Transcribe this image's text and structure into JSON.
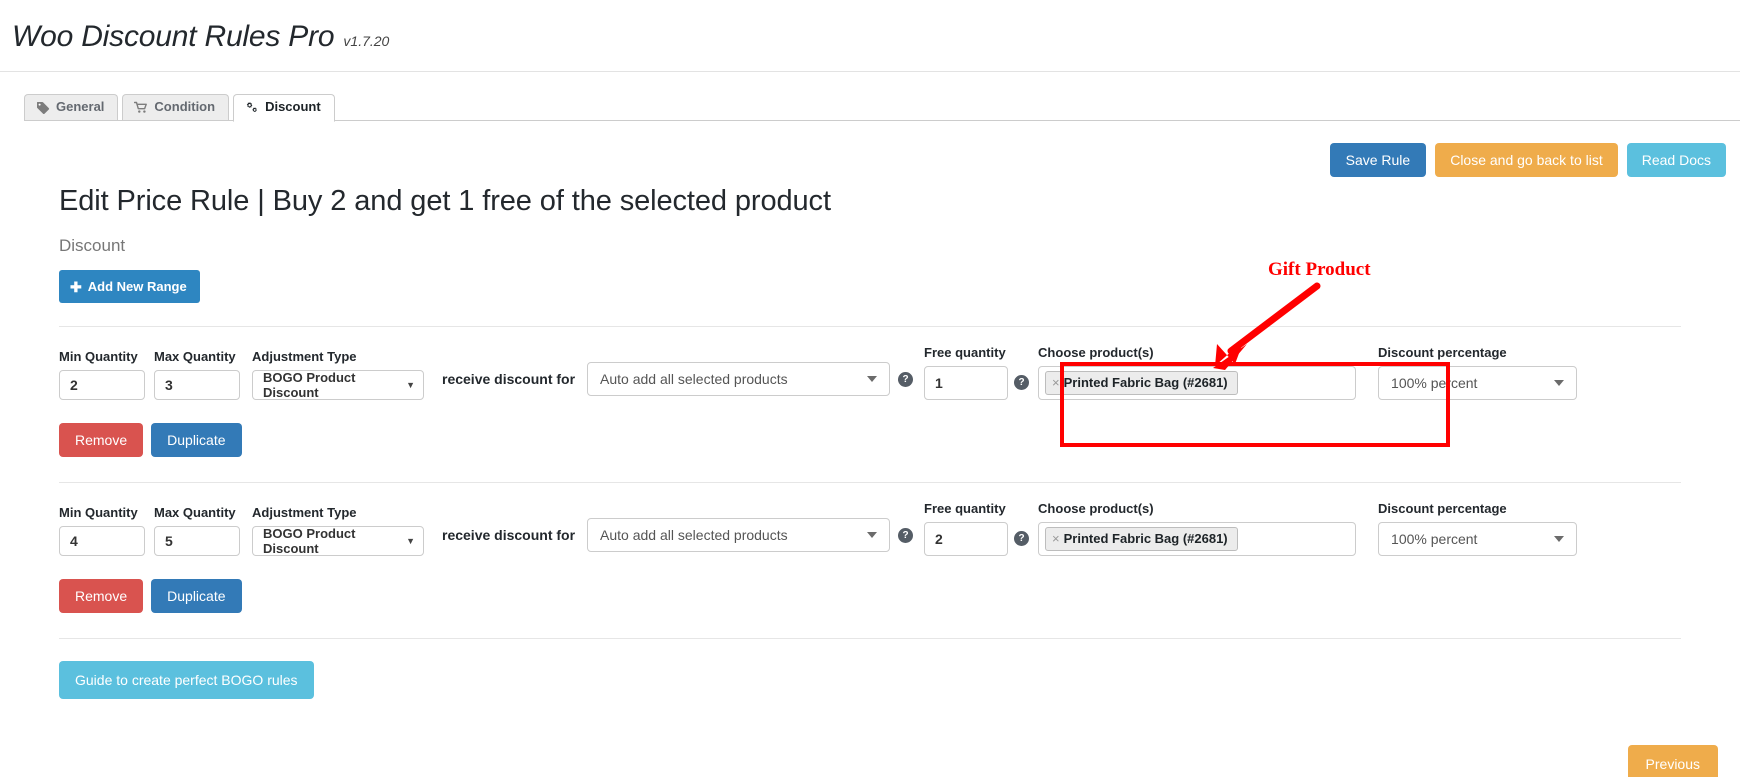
{
  "header": {
    "title": "Woo Discount Rules Pro",
    "version": "v1.7.20"
  },
  "tabs": [
    {
      "label": "General",
      "icon": "tag-icon",
      "active": false
    },
    {
      "label": "Condition",
      "icon": "cart-icon",
      "active": false
    },
    {
      "label": "Discount",
      "icon": "gears-icon",
      "active": true
    }
  ],
  "actions": {
    "save": "Save Rule",
    "close": "Close and go back to list",
    "docs": "Read Docs"
  },
  "main": {
    "page_title": "Edit Price Rule | Buy 2 and get 1 free of the selected product",
    "section_label": "Discount",
    "add_range": "Add New Range",
    "labels": {
      "min_quantity": "Min Quantity",
      "max_quantity": "Max Quantity",
      "adjustment_type": "Adjustment Type",
      "receive_discount_for": "receive discount for",
      "free_quantity": "Free quantity",
      "choose_products": "Choose product(s)",
      "discount_percentage": "Discount percentage",
      "remove": "Remove",
      "duplicate": "Duplicate"
    },
    "rules": [
      {
        "min_quantity": "2",
        "max_quantity": "3",
        "adjustment_type": "BOGO Product Discount",
        "receive_discount_for": "Auto add all selected products",
        "free_quantity": "1",
        "products": [
          "Printed Fabric Bag (#2681)"
        ],
        "discount_percentage": "100% percent"
      },
      {
        "min_quantity": "4",
        "max_quantity": "5",
        "adjustment_type": "BOGO Product Discount",
        "receive_discount_for": "Auto add all selected products",
        "free_quantity": "2",
        "products": [
          "Printed Fabric Bag (#2681)"
        ],
        "discount_percentage": "100% percent"
      }
    ]
  },
  "annotation": {
    "label": "Gift Product",
    "color": "#ff0000"
  },
  "footer": {
    "guide": "Guide to create perfect BOGO rules",
    "previous": "Previous"
  }
}
